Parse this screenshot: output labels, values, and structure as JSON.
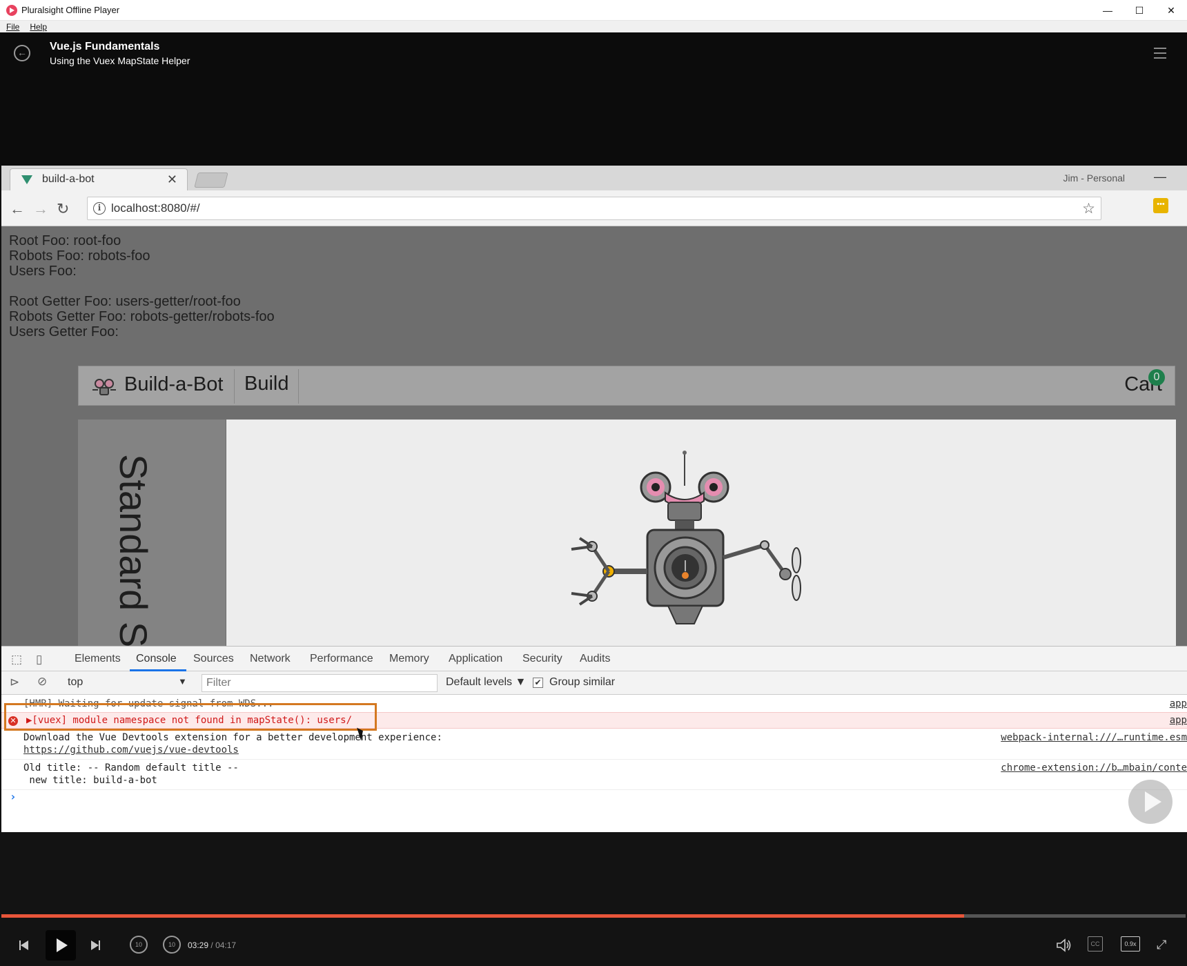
{
  "window": {
    "title": "Pluralsight Offline Player",
    "minimize": "—",
    "maximize": "☐",
    "close": "✕",
    "menu": [
      "File",
      "Help"
    ]
  },
  "header": {
    "course_title": "Vue.js Fundamentals",
    "clip_title": "Using the Vuex MapState Helper"
  },
  "browser": {
    "tab_title": "build-a-bot",
    "tab_close": "✕",
    "profile": "Jim - Personal",
    "url": "localhost:8080/#/"
  },
  "page": {
    "lines": [
      "Root Foo: root-foo",
      "Robots Foo: robots-foo",
      "Users Foo:",
      "Root Getter Foo: users-getter/root-foo",
      "Robots Getter Foo: robots-getter/robots-foo",
      "Users Getter Foo:"
    ],
    "nav": {
      "brand": "Build-a-Bot",
      "build": "Build",
      "cart": "Cart",
      "cart_count": "0"
    },
    "sidebar_text": "Standard Sidebar"
  },
  "devtools": {
    "tabs": [
      "Elements",
      "Console",
      "Sources",
      "Network",
      "Performance",
      "Memory",
      "Application",
      "Security",
      "Audits"
    ],
    "active_tab": "Console",
    "context": "top",
    "filter_placeholder": "Filter",
    "levels": "Default levels ▼",
    "group_similar": "Group similar",
    "group_similar_checked": true,
    "messages": [
      {
        "text": "[HMR] Waiting for update signal from WDS...",
        "source": "app",
        "level": "info"
      },
      {
        "text": "▶[vuex] module namespace not found in mapState(): users/",
        "source": "app",
        "level": "error"
      },
      {
        "text": "Download the Vue Devtools extension for a better development experience:",
        "link": "https://github.com/vuejs/vue-devtools",
        "source": "webpack-internal:///…runtime.esm",
        "level": "info"
      },
      {
        "text": "Old title: -- Random default title --",
        "text2": " new title: build-a-bot",
        "source": "chrome-extension://b…mbain/conte",
        "level": "info"
      }
    ]
  },
  "player": {
    "current_time": "03:29",
    "separator": "/",
    "duration": "04:17",
    "progress_fraction": 0.813,
    "speed": "0.9x",
    "cc": "CC",
    "seek_back_label": "10",
    "seek_fwd_label": "10",
    "accent_color": "#e8553a"
  }
}
